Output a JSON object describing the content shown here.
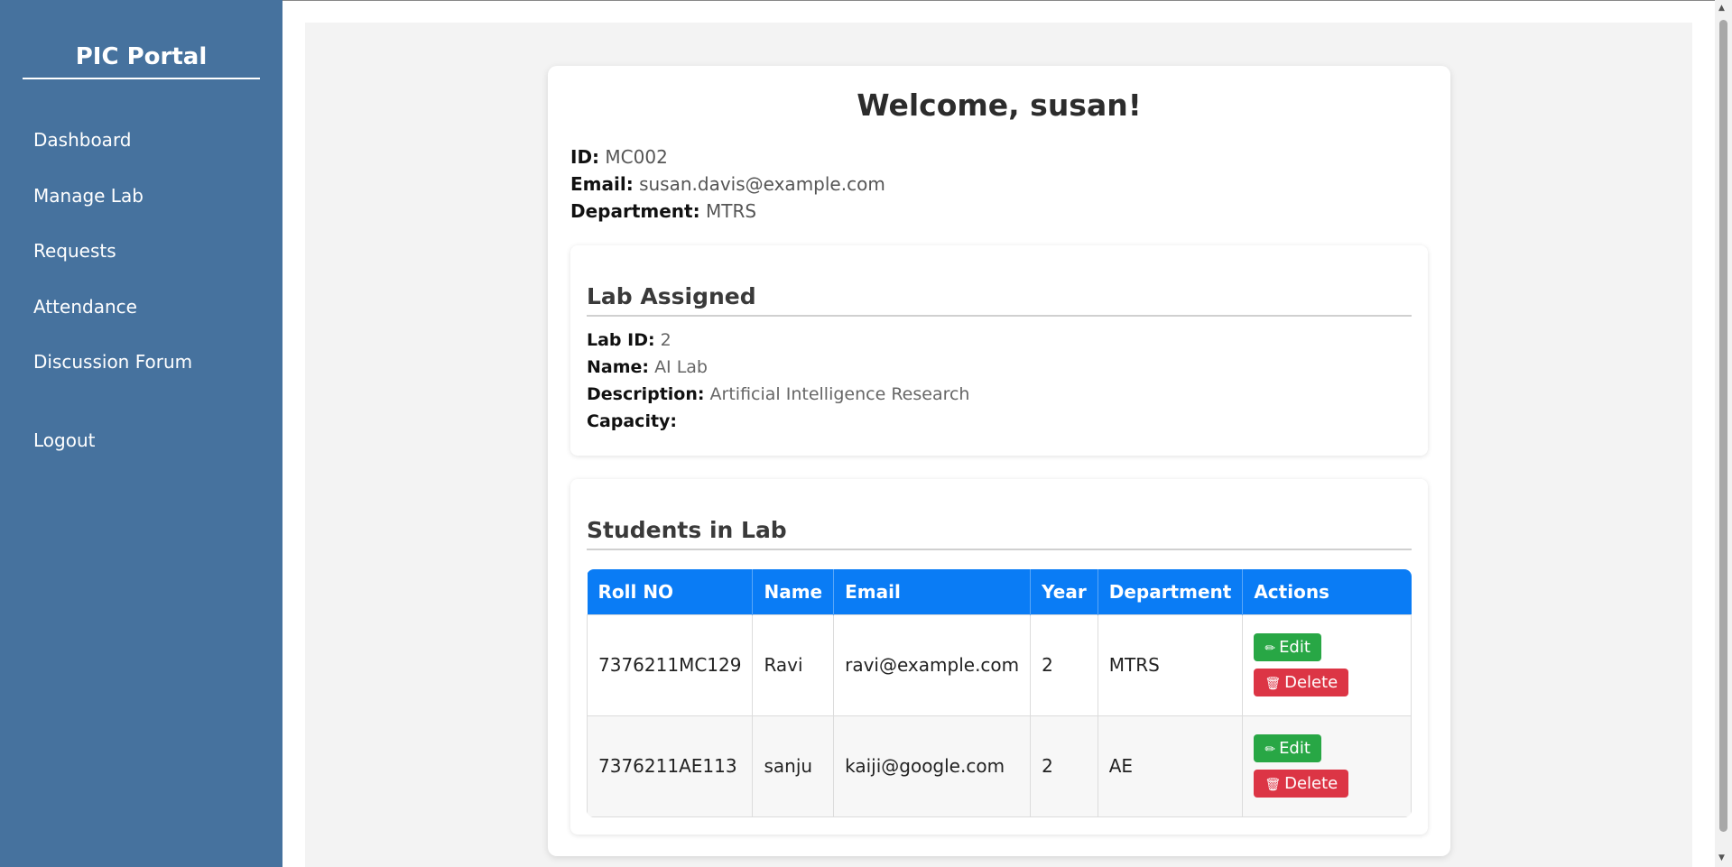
{
  "sidebar": {
    "title": "PIC Portal",
    "items": [
      {
        "label": "Dashboard"
      },
      {
        "label": "Manage Lab"
      },
      {
        "label": "Requests"
      },
      {
        "label": "Attendance"
      },
      {
        "label": "Discussion Forum"
      },
      {
        "label": "Logout"
      }
    ]
  },
  "profile": {
    "welcome": "Welcome, susan!",
    "id_label": "ID:",
    "id": "MC002",
    "email_label": "Email:",
    "email": "susan.davis@example.com",
    "dept_label": "Department:",
    "department": "MTRS"
  },
  "lab": {
    "heading": "Lab Assigned",
    "id_label": "Lab ID:",
    "id": "2",
    "name_label": "Name:",
    "name": "AI Lab",
    "desc_label": "Description:",
    "description": "Artificial Intelligence Research",
    "capacity_label": "Capacity:",
    "capacity": ""
  },
  "students": {
    "heading": "Students in Lab",
    "columns": [
      "Roll NO",
      "Name",
      "Email",
      "Year",
      "Department",
      "Actions"
    ],
    "rows": [
      {
        "roll": "7376211MC129",
        "name": "Ravi",
        "email": "ravi@example.com",
        "year": "2",
        "department": "MTRS"
      },
      {
        "roll": "7376211AE113",
        "name": "sanju",
        "email": "kaiji@google.com",
        "year": "2",
        "department": "AE"
      }
    ],
    "edit_label": "Edit",
    "delete_label": "Delete"
  },
  "colors": {
    "sidebar": "#46729e",
    "table_header": "#0a7cf5",
    "edit": "#28a745",
    "delete": "#dc3545"
  }
}
